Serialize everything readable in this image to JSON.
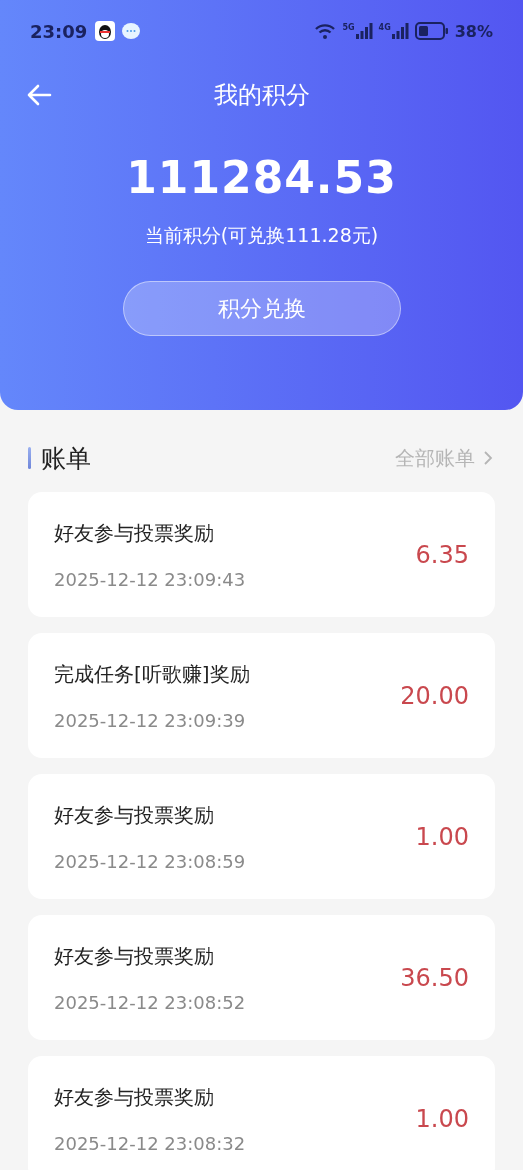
{
  "status_bar": {
    "time": "23:09",
    "network_1": "5G",
    "network_2": "4G",
    "battery": "38%"
  },
  "header": {
    "title": "我的积分"
  },
  "points": {
    "value": "111284.53",
    "caption": "当前积分(可兑换111.28元)",
    "exchange_button": "积分兑换"
  },
  "bills": {
    "title": "账单",
    "all_link": "全部账单",
    "items": [
      {
        "name": "好友参与投票奖励",
        "time": "2025-12-12 23:09:43",
        "amount": "6.35"
      },
      {
        "name": "完成任务[听歌赚]奖励",
        "time": "2025-12-12 23:09:39",
        "amount": "20.00"
      },
      {
        "name": "好友参与投票奖励",
        "time": "2025-12-12 23:08:59",
        "amount": "1.00"
      },
      {
        "name": "好友参与投票奖励",
        "time": "2025-12-12 23:08:52",
        "amount": "36.50"
      },
      {
        "name": "好友参与投票奖励",
        "time": "2025-12-12 23:08:32",
        "amount": "1.00"
      }
    ]
  }
}
